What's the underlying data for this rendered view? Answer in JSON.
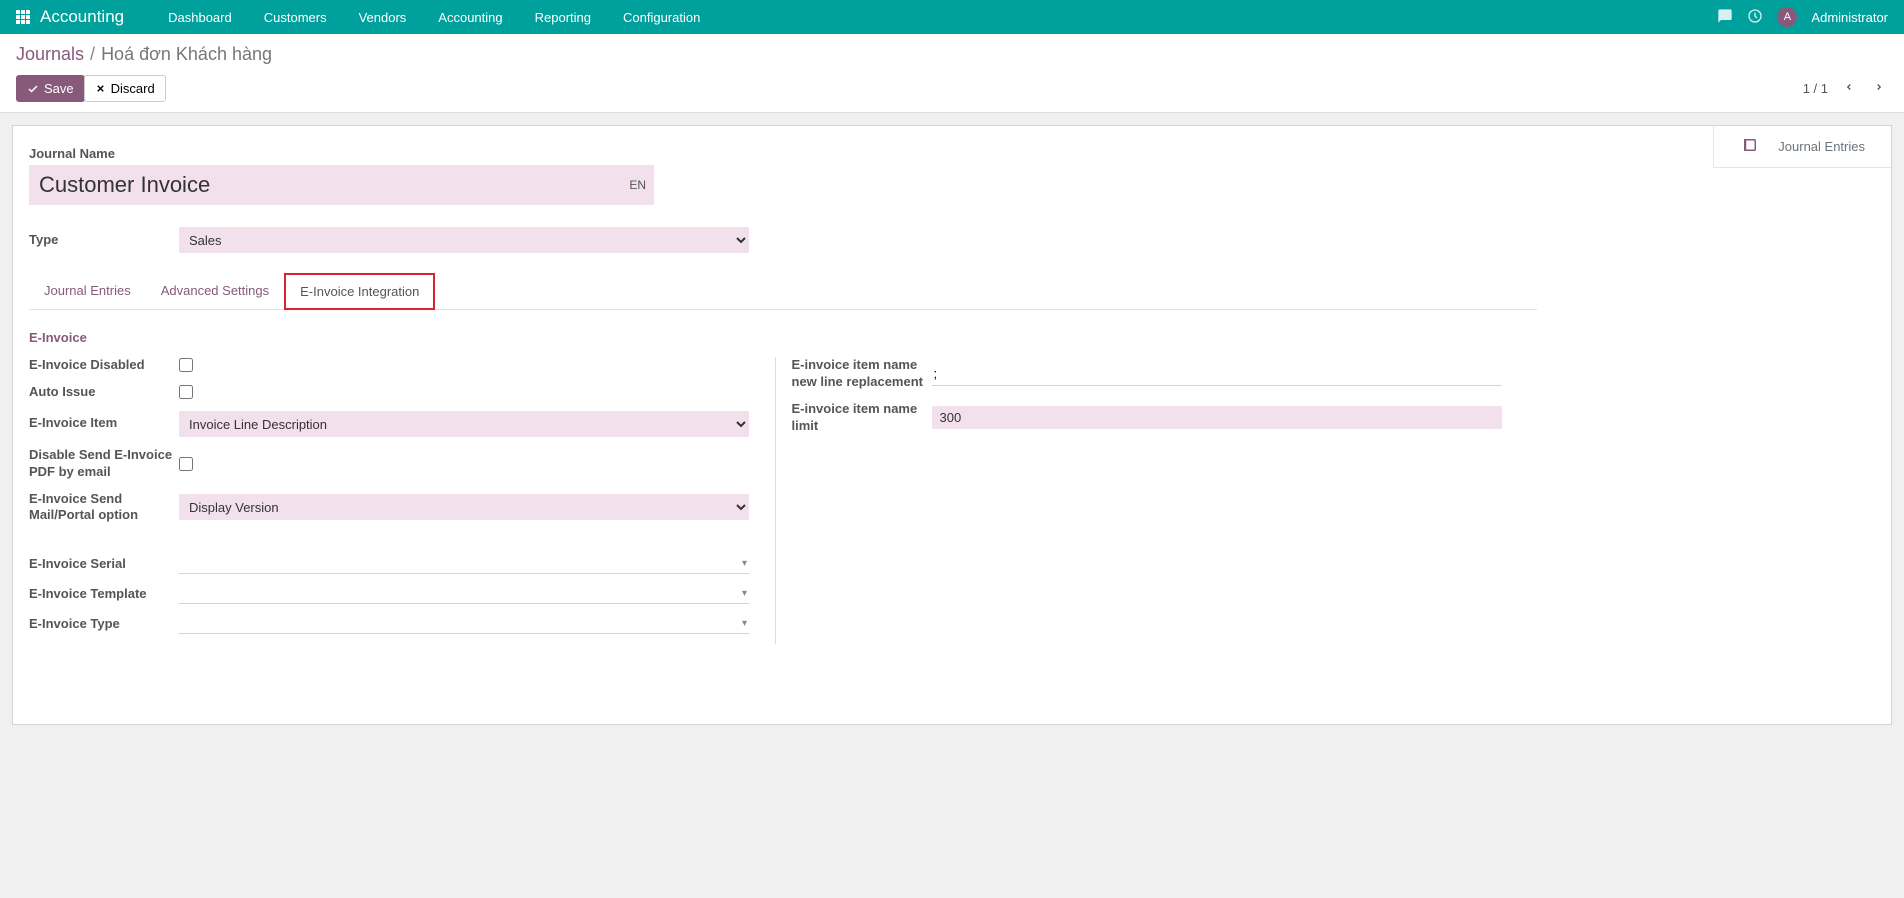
{
  "nav": {
    "brand": "Accounting",
    "links": [
      "Dashboard",
      "Customers",
      "Vendors",
      "Accounting",
      "Reporting",
      "Configuration"
    ],
    "avatar_initial": "A",
    "user": "Administrator"
  },
  "breadcrumb": {
    "root": "Journals",
    "current": "Hoá đơn Khách hàng"
  },
  "actions": {
    "save": "Save",
    "discard": "Discard"
  },
  "pager": {
    "text": "1 / 1"
  },
  "stat": {
    "journal_entries": "Journal Entries"
  },
  "form": {
    "journal_name_label": "Journal Name",
    "journal_name_value": "Customer Invoice",
    "lang": "EN",
    "type_label": "Type",
    "type_value": "Sales"
  },
  "tabs": [
    "Journal Entries",
    "Advanced Settings",
    "E-Invoice Integration"
  ],
  "einvoice": {
    "section": "E-Invoice",
    "left": {
      "disabled": "E-Invoice Disabled",
      "auto_issue": "Auto Issue",
      "item": "E-Invoice Item",
      "item_value": "Invoice Line Description",
      "disable_send_pdf": "Disable Send E-Invoice PDF by email",
      "send_option": "E-Invoice Send Mail/Portal option",
      "send_option_value": "Display Version",
      "serial": "E-Invoice Serial",
      "template": "E-Invoice Template",
      "type": "E-Invoice Type"
    },
    "right": {
      "newline": "E-invoice item name new line replacement",
      "newline_value": ";",
      "limit": "E-invoice item name limit",
      "limit_value": "300"
    }
  }
}
